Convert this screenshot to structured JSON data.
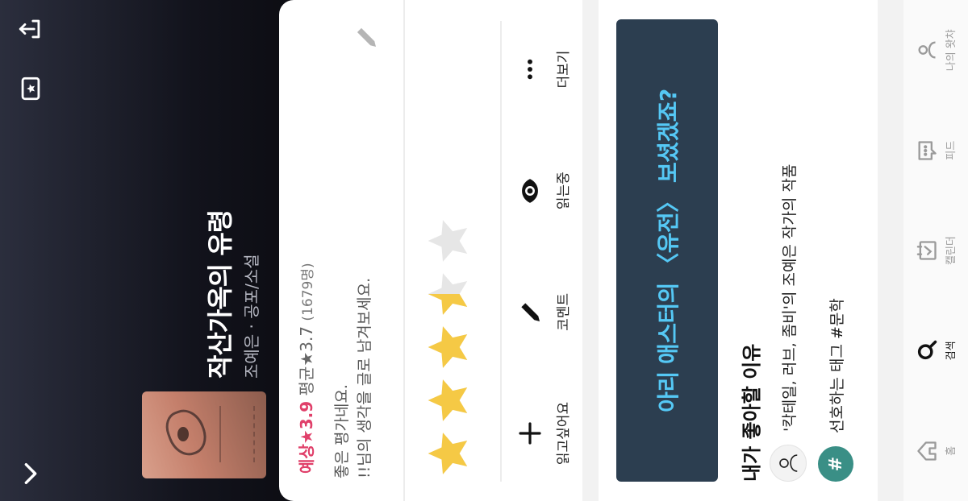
{
  "header": {
    "title": "작산가옥의 유령",
    "subtitle": "조예은 · 공포/소설"
  },
  "rating": {
    "predicted_label": "예상★3.9",
    "average_label": "평균★3.7",
    "count_label": "(1679명)",
    "predicted_value": 3.9,
    "average_value": 3.7,
    "rating_count": 1679,
    "user_stars_value": 3.5,
    "user_stars_max": 5
  },
  "comment": {
    "line1": "좋은 평가네요.",
    "line2": "!!님의 생각을 글로 남겨보세요."
  },
  "actions": [
    {
      "label": "읽고싶어요",
      "icon": "plus-icon"
    },
    {
      "label": "코멘트",
      "icon": "pencil-icon"
    },
    {
      "label": "읽는중",
      "icon": "eye-icon"
    },
    {
      "label": "더보기",
      "icon": "more-icon"
    }
  ],
  "banner": {
    "text": "아리 애스터의 〈유전〉 보셨겠죠?"
  },
  "reasons": {
    "title": "내가 좋아할 이유",
    "items": [
      {
        "text": "'칵테일, 러브, 좀비'의 조예은 작가의 작품",
        "icon": "user-icon"
      },
      {
        "text": "선호하는 태그 #문학",
        "icon": "hash-icon"
      }
    ]
  },
  "nav": [
    {
      "label": "홈",
      "icon": "home-icon",
      "active": false
    },
    {
      "label": "검색",
      "icon": "search-icon",
      "active": true
    },
    {
      "label": "캘린더",
      "icon": "calendar-icon",
      "active": false
    },
    {
      "label": "피드",
      "icon": "feed-icon",
      "active": false
    },
    {
      "label": "나의 왓챠",
      "icon": "profile-icon",
      "active": false
    }
  ],
  "colors": {
    "predicted": "#e0406a",
    "star_filled": "#f5c945",
    "star_empty": "#e6e6e6",
    "banner_bg": "#2c3e50",
    "banner_text": "#55c8f5",
    "tag_badge": "#3a8f86"
  }
}
